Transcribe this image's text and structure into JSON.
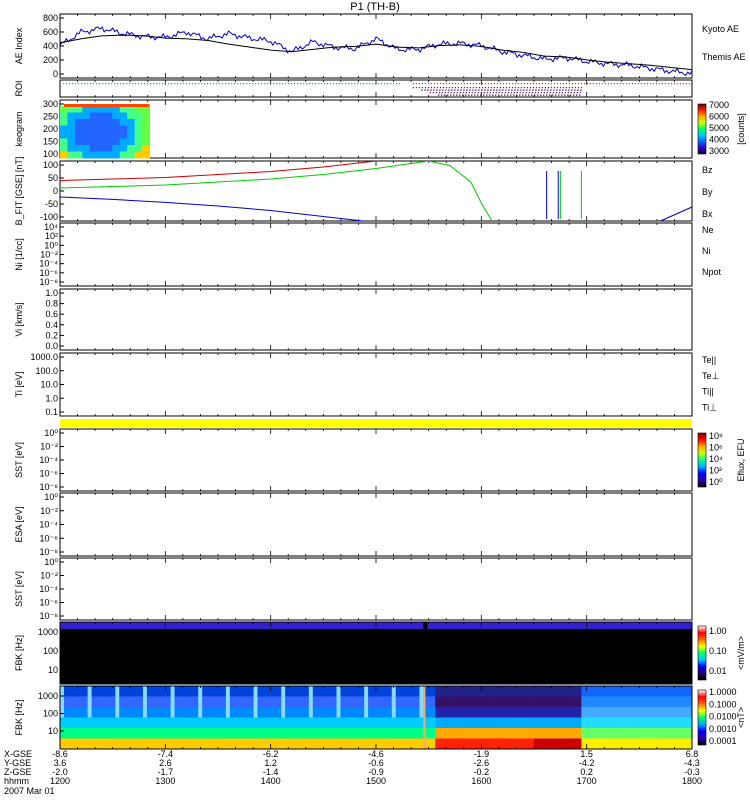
{
  "title": "P1 (TH-B)",
  "date_label": "2007 Mar 01",
  "time_axis": {
    "row_labels": [
      "X-GSE",
      "Y-GSE",
      "Z-GSE",
      "hhmm"
    ],
    "ticks": [
      {
        "x_gse": "-8.6",
        "y_gse": "3.6",
        "z_gse": "-2.0",
        "hhmm": "1200"
      },
      {
        "x_gse": "-7.4",
        "y_gse": "2.6",
        "z_gse": "-1.7",
        "hhmm": "1300"
      },
      {
        "x_gse": "-6.2",
        "y_gse": "1.2",
        "z_gse": "-1.4",
        "hhmm": "1400"
      },
      {
        "x_gse": "-4.6",
        "y_gse": "-0.6",
        "z_gse": "-0.9",
        "hhmm": "1500"
      },
      {
        "x_gse": "-1.9",
        "y_gse": "-2.6",
        "z_gse": "-0.2",
        "hhmm": "1600"
      },
      {
        "x_gse": "1.5",
        "y_gse": "-4.2",
        "z_gse": "0.2",
        "hhmm": "1700"
      },
      {
        "x_gse": "6.8",
        "y_gse": "-4.3",
        "z_gse": "-0.3",
        "hhmm": "1800"
      }
    ]
  },
  "colors": {
    "kyoto": "#0000cc",
    "themis": "#000000",
    "red": "#cc0000",
    "green": "#00cc00",
    "blue": "#0000cc",
    "yellow": "#ffff00"
  },
  "chart_data": [
    {
      "id": "ae",
      "type": "line",
      "ylabel": "AE Index",
      "ylim": [
        -50,
        800
      ],
      "y_ticks": [
        "800",
        "600",
        "400",
        "200",
        "0"
      ],
      "x_hours": [
        12.0,
        12.2,
        12.4,
        12.6,
        12.8,
        13.0,
        13.2,
        13.4,
        13.6,
        13.8,
        14.0,
        14.2,
        14.4,
        14.6,
        14.8,
        15.0,
        15.2,
        15.4,
        15.6,
        15.8,
        16.0,
        16.2,
        16.4,
        16.6,
        16.8,
        17.0,
        17.2,
        17.4,
        17.6,
        17.8,
        18.0
      ],
      "series": [
        {
          "name": "Kyoto AE",
          "color": "#0000cc",
          "values": [
            380,
            560,
            610,
            540,
            500,
            490,
            560,
            470,
            540,
            480,
            440,
            300,
            430,
            360,
            340,
            470,
            330,
            330,
            400,
            410,
            380,
            300,
            250,
            200,
            220,
            170,
            140,
            120,
            80,
            40,
            10
          ]
        },
        {
          "name": "Themis AE",
          "color": "#000000",
          "values": [
            420,
            470,
            510,
            520,
            510,
            480,
            470,
            450,
            400,
            360,
            320,
            300,
            330,
            360,
            370,
            400,
            360,
            350,
            380,
            390,
            370,
            320,
            290,
            240,
            230,
            190,
            160,
            140,
            120,
            90,
            60
          ]
        }
      ]
    },
    {
      "id": "roi",
      "type": "dots",
      "ylabel": "ROI"
    },
    {
      "id": "keogram",
      "type": "heatmap",
      "ylabel": "keogram",
      "ylim": [
        100,
        300
      ],
      "y_ticks": [
        "300",
        "250",
        "200",
        "150",
        "100"
      ],
      "colorbar": {
        "label": "[counts]",
        "ticks": [
          "7000",
          "6000",
          "5000",
          "4000",
          "3000"
        ]
      }
    },
    {
      "id": "bfit",
      "type": "line",
      "ylabel": "B_FIT [GSE] [nT]",
      "ylim": [
        -100,
        100
      ],
      "y_ticks": [
        "100",
        "50",
        "0",
        "-50",
        "-100"
      ],
      "x_hours": [
        12.0,
        12.5,
        13.0,
        13.5,
        14.0,
        14.5,
        15.0,
        15.3,
        15.5,
        15.7,
        15.9,
        16.0,
        16.1,
        16.2,
        16.25
      ],
      "series": [
        {
          "name": "Bz",
          "color": "#cc0000",
          "values": [
            35,
            40,
            45,
            55,
            65,
            80,
            100,
            120,
            140,
            160,
            180,
            190,
            200,
            210,
            220
          ]
        },
        {
          "name": "By",
          "color": "#00cc00",
          "values": [
            10,
            15,
            20,
            30,
            40,
            55,
            75,
            90,
            100,
            85,
            30,
            -40,
            -100,
            -150,
            -200
          ]
        },
        {
          "name": "Bx",
          "color": "#0000cc",
          "values": [
            -20,
            -28,
            -38,
            -50,
            -65,
            -85,
            -105,
            -120,
            -140,
            -160,
            -180,
            -200,
            -220,
            -240,
            -250
          ]
        }
      ]
    },
    {
      "id": "ni",
      "type": "line",
      "ylabel": "Ni [1/cc]",
      "y_ticks": [
        "10⁴",
        "10²",
        "10⁰",
        "10⁻²",
        "10⁻⁴",
        "10⁻⁶",
        "10⁻⁸"
      ],
      "series": [
        {
          "name": "Ne",
          "color": "#cc0000"
        },
        {
          "name": "Ni",
          "color": "#000000"
        },
        {
          "name": "Npot",
          "color": "#0000cc"
        }
      ]
    },
    {
      "id": "vi",
      "type": "line",
      "ylabel": "Vi [km/s]",
      "y_ticks": [
        "1.0",
        "0.8",
        "0.6",
        "0.4",
        "0.2",
        "0.0"
      ]
    },
    {
      "id": "ti",
      "type": "line",
      "ylabel": "Ti [eV]",
      "y_ticks": [
        "1000.0",
        "100.0",
        "10.0",
        "1.0",
        "0.1"
      ],
      "series": [
        {
          "name": "Te||",
          "color": "#000000"
        },
        {
          "name": "Te⊥",
          "color": "#cc0000"
        },
        {
          "name": "Ti||",
          "color": "#00cc00"
        },
        {
          "name": "Ti⊥",
          "color": "#0000cc"
        }
      ]
    },
    {
      "id": "sst_full",
      "type": "heatmap",
      "ylabel": "SST [eV]",
      "y_ticks": [
        "10⁰",
        "10⁻²",
        "10⁻⁴",
        "10⁻⁶",
        "10⁻⁸"
      ],
      "colorbar": {
        "label": "Eflux, EFU",
        "ticks": [
          "10⁸",
          "10⁶",
          "10⁴",
          "10²",
          "10⁰"
        ]
      }
    },
    {
      "id": "esa",
      "type": "heatmap",
      "ylabel": "ESA [eV]",
      "y_ticks": [
        "10⁰",
        "10⁻²",
        "10⁻⁴",
        "10⁻⁶",
        "10⁻⁸"
      ]
    },
    {
      "id": "sst_reduced",
      "type": "heatmap",
      "ylabel": "SST [eV]",
      "y_ticks": [
        "10⁰",
        "10⁻²",
        "10⁻⁴",
        "10⁻⁶",
        "10⁻⁸"
      ]
    },
    {
      "id": "fbk_edc",
      "type": "heatmap",
      "ylabel": "FBK [Hz]",
      "y_ticks": [
        "1000",
        "100",
        "10"
      ],
      "colorbar": {
        "label": "<mV/m>",
        "ticks": [
          "1.00",
          "0.10",
          "0.01"
        ]
      }
    },
    {
      "id": "fbk_scm",
      "type": "heatmap",
      "ylabel": "FBK [Hz]",
      "y_ticks": [
        "1000",
        "100",
        "10"
      ],
      "colorbar": {
        "label": "<nT>",
        "ticks": [
          "1.0000",
          "0.1000",
          "0.0100",
          "0.0010",
          "0.0001"
        ]
      }
    }
  ]
}
